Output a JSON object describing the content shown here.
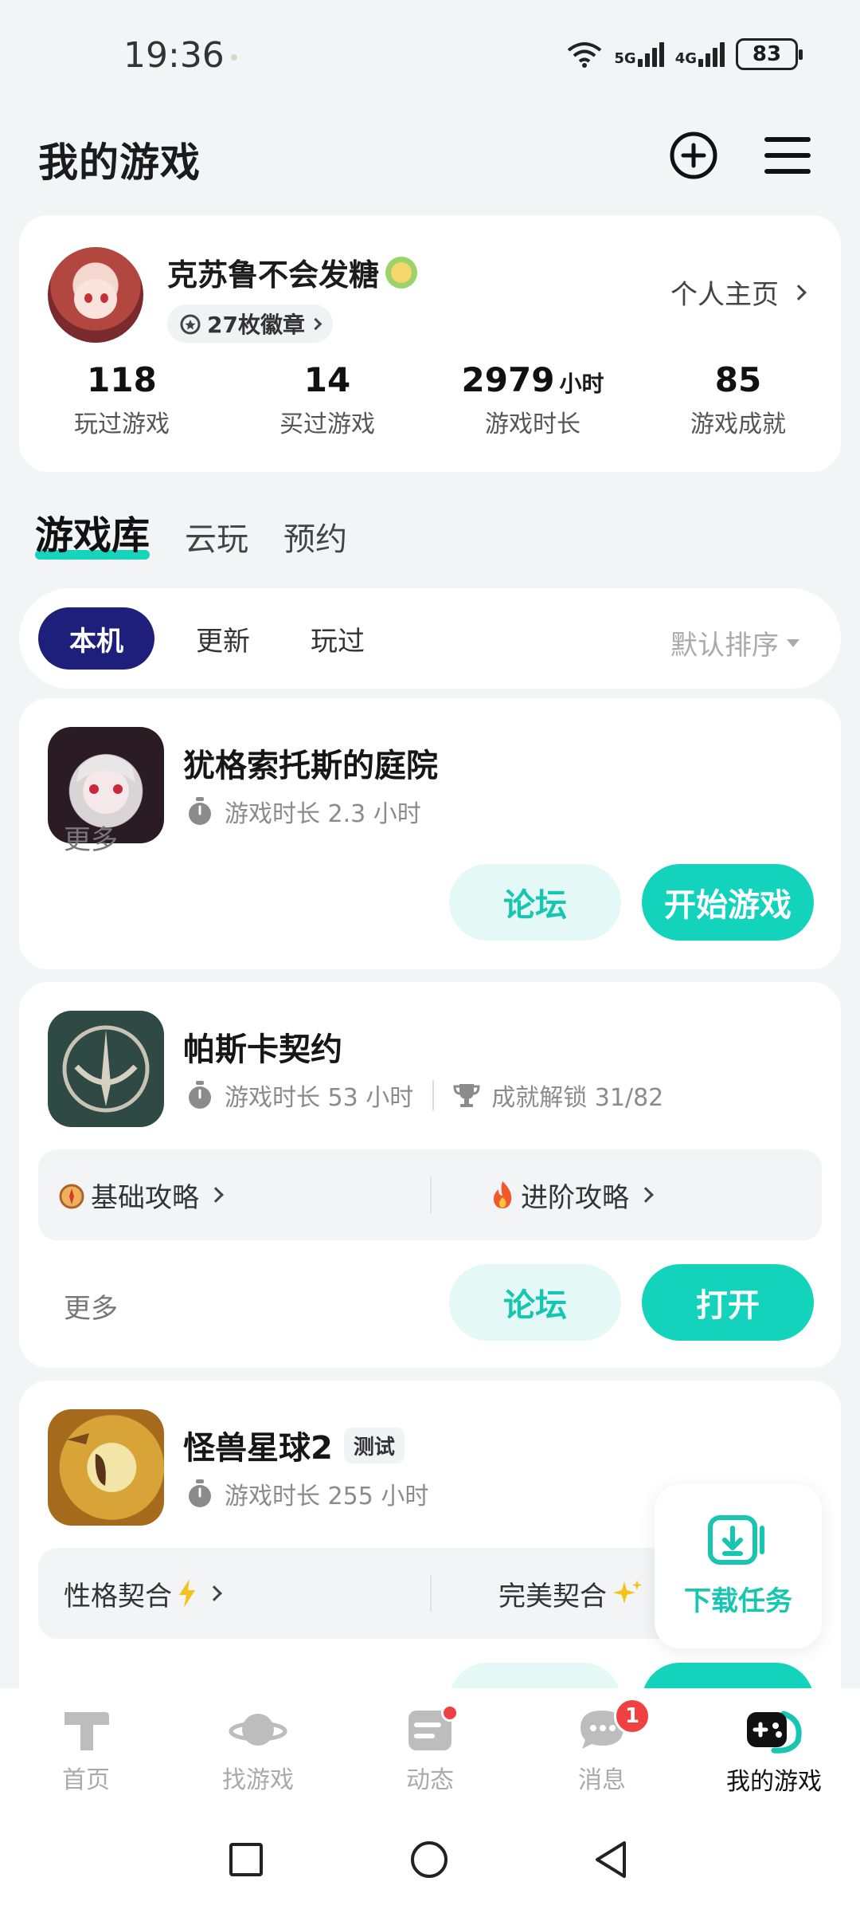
{
  "status_bar": {
    "time": "19:36",
    "net1": "5G",
    "net2": "4G",
    "battery": "83"
  },
  "header": {
    "title": "我的游戏",
    "add_icon": "plus-circle-icon",
    "menu_icon": "hamburger-menu-icon"
  },
  "profile": {
    "username": "克苏鲁不会发糖",
    "medals": "27枚徽章",
    "homepage_link": "个人主页",
    "stats": [
      {
        "value": "118",
        "unit": "",
        "label": "玩过游戏"
      },
      {
        "value": "14",
        "unit": "",
        "label": "买过游戏"
      },
      {
        "value": "2979",
        "unit": "小时",
        "label": "游戏时长"
      },
      {
        "value": "85",
        "unit": "",
        "label": "游戏成就"
      }
    ]
  },
  "tabs": [
    "游戏库",
    "云玩",
    "预约"
  ],
  "filters": {
    "chips": [
      "本机",
      "更新",
      "玩过"
    ],
    "sort": "默认排序"
  },
  "games": [
    {
      "name": "犹格索托斯的庭院",
      "playtime": "游戏时长 2.3 小时",
      "more": "更多",
      "forum": "论坛",
      "action": "开始游戏"
    },
    {
      "name": "帕斯卡契约",
      "playtime": "游戏时长 53 小时",
      "achievements": "成就解锁 31/82",
      "guide_left": "基础攻略",
      "guide_right": "进阶攻略",
      "more": "更多",
      "forum": "论坛",
      "action": "打开"
    },
    {
      "name": "怪兽星球2",
      "tag": "测试",
      "playtime": "游戏时长 255 小时",
      "guide_left": "性格契合",
      "guide_right": "完美契合"
    }
  ],
  "download": {
    "label": "下载任务"
  },
  "bottom_nav": [
    {
      "label": "首页",
      "icon": "home-icon"
    },
    {
      "label": "找游戏",
      "icon": "planet-icon"
    },
    {
      "label": "动态",
      "icon": "feed-icon"
    },
    {
      "label": "消息",
      "icon": "message-icon",
      "badge": "1"
    },
    {
      "label": "我的游戏",
      "icon": "gamepad-icon"
    }
  ],
  "colors": {
    "accent": "#14d3bd",
    "chip_active": "#1e1f7a",
    "badge_red": "#f04040"
  }
}
